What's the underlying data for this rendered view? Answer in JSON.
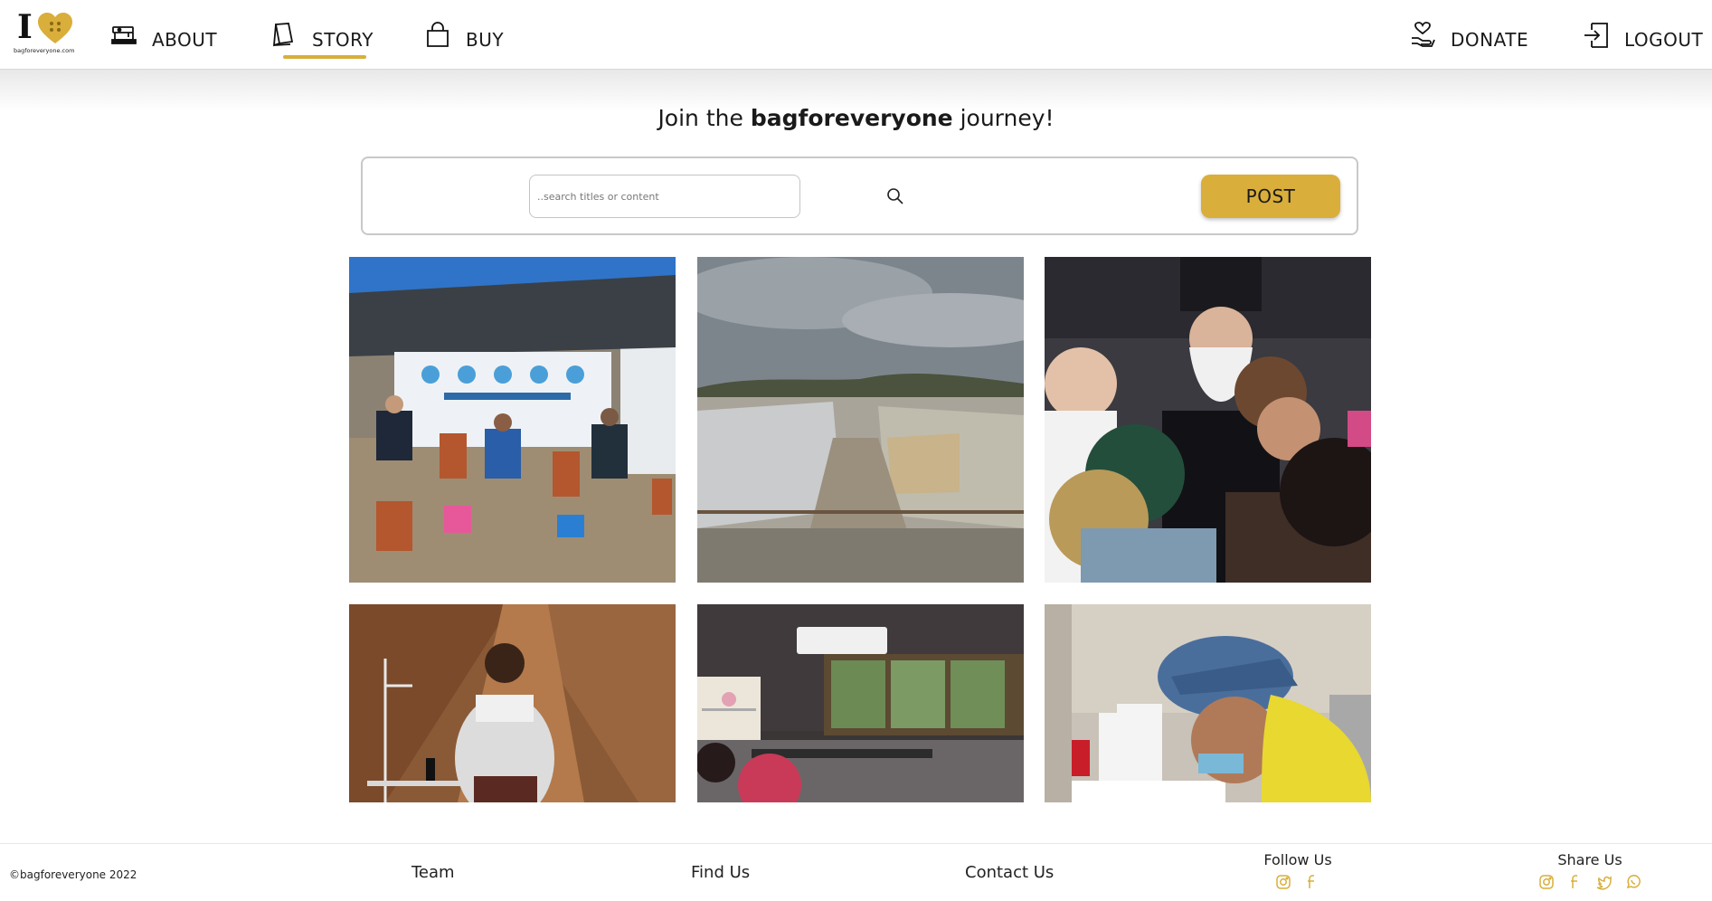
{
  "brand": {
    "logo_letter": "I",
    "logo_text": "bagforeveryone.com",
    "accent": "#d9ae3a"
  },
  "nav": {
    "about": {
      "label": "ABOUT",
      "icon": "sewing-machine-icon"
    },
    "story": {
      "label": "STORY",
      "icon": "book-icon",
      "active": true
    },
    "buy": {
      "label": "BUY",
      "icon": "shopping-bag-icon"
    },
    "donate": {
      "label": "DONATE",
      "icon": "donate-hand-heart-icon"
    },
    "logout": {
      "label": "LOGOUT",
      "icon": "logout-icon"
    }
  },
  "headline": {
    "prefix": "Join the ",
    "brand": "bagforeveryone",
    "suffix": " journey!"
  },
  "search": {
    "placeholder": "..search titles or content",
    "value": ""
  },
  "post_button": "POST",
  "stories": [
    {
      "scene": "handwashing-station-tent"
    },
    {
      "scene": "tent-camp"
    },
    {
      "scene": "crowd-gathering"
    },
    {
      "scene": "tailor-with-tape"
    },
    {
      "scene": "sewing-workshop-room"
    },
    {
      "scene": "man-at-sewing-machine"
    }
  ],
  "footer": {
    "copyright": "©bagforeveryone 2022",
    "team": "Team",
    "find_us": "Find Us",
    "contact_us": "Contact Us",
    "follow_us": "Follow Us",
    "follow_icons": [
      "instagram-icon",
      "facebook-icon"
    ],
    "share_us": "Share Us",
    "share_icons": [
      "instagram-icon",
      "facebook-icon",
      "twitter-icon",
      "whatsapp-icon"
    ]
  }
}
